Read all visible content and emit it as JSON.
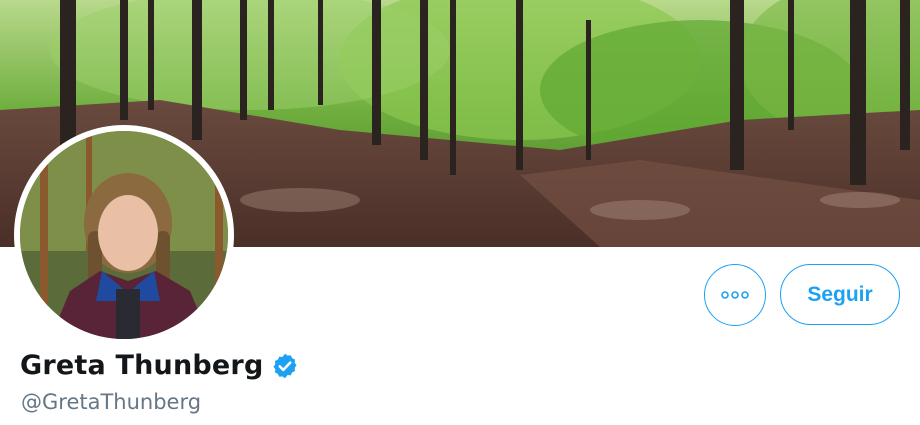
{
  "profile": {
    "name": "Greta Thunberg",
    "handle": "@GretaThunberg"
  },
  "actions": {
    "follow_label": "Seguir",
    "more_icon": "more-options-icon"
  },
  "colors": {
    "accent": "#1da1f2",
    "name_text": "#14171a",
    "handle_text": "#657786"
  },
  "images": {
    "banner": "forest-path-panorama",
    "avatar": "profile-photo"
  }
}
